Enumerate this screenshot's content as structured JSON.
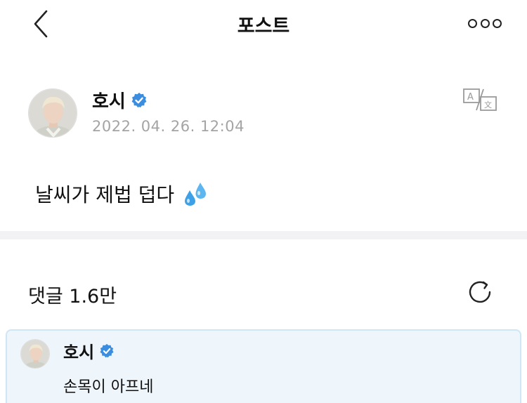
{
  "topbar": {
    "title": "포스트",
    "back_icon": "chevron-left-icon",
    "more_icon": "more-dots-icon"
  },
  "post": {
    "author": "호시",
    "verified_icon": "verified-badge-icon",
    "date": "2022. 04. 26. 12:04",
    "text": "날씨가 제법 덥다",
    "emoji_icon": "sweat-droplets-icon",
    "translate_icon": "translate-icon"
  },
  "comments": {
    "label": "댓글 1.6만",
    "refresh_icon": "refresh-icon",
    "items": [
      {
        "author": "호시",
        "text": "손목이 아프네"
      }
    ]
  },
  "colors": {
    "verified_blue": "#3b8de0",
    "date_gray": "#a4a4a4",
    "highlight_bg": "#eef6fc",
    "highlight_border": "#cfe6f6",
    "divider": "#f2f2f4"
  }
}
